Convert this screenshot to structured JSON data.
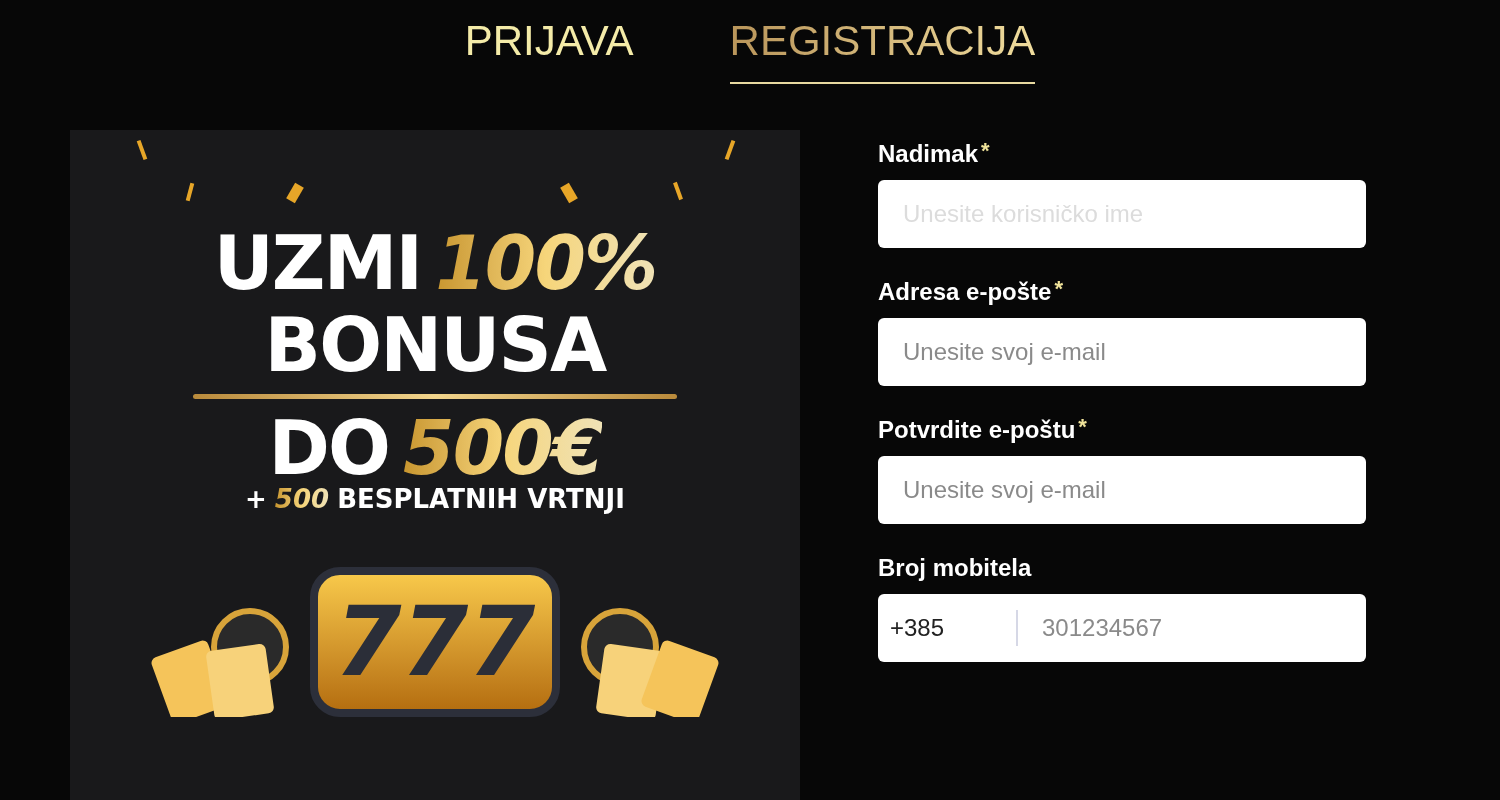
{
  "tabs": [
    {
      "label": "PRIJAVA",
      "selected": false
    },
    {
      "label": "REGISTRACIJA",
      "selected": true
    }
  ],
  "banner": {
    "lines": [
      [
        {
          "text": "UZMI",
          "gold": false
        },
        {
          "text": "100%",
          "gold": true
        }
      ],
      [
        {
          "text": "BONUSA",
          "gold": false
        }
      ],
      [
        {
          "text": "DO",
          "gold": false
        },
        {
          "text": "500€",
          "gold": true
        }
      ]
    ],
    "sub": [
      {
        "text": "+",
        "gold": false
      },
      {
        "text": "500",
        "gold": true
      },
      {
        "text": "BESPLATNIH VRTNJI",
        "gold": false
      }
    ],
    "sign": "777"
  },
  "form": {
    "fields": [
      {
        "kind": "text",
        "label": "Nadimak",
        "marker": "*",
        "placeholder": "Unesite korisničko ime"
      },
      {
        "kind": "text",
        "label": "Adresa e-pošte",
        "marker": "*",
        "placeholder": "Unesite svoj e-mail"
      },
      {
        "kind": "text",
        "label": "Potvrdite e-poštu",
        "marker": "*",
        "placeholder": "Unesite svoj e-mail"
      },
      {
        "kind": "phone",
        "label": "Broj mobitela",
        "prefix": "+385",
        "placeholder": "301234567"
      }
    ]
  }
}
